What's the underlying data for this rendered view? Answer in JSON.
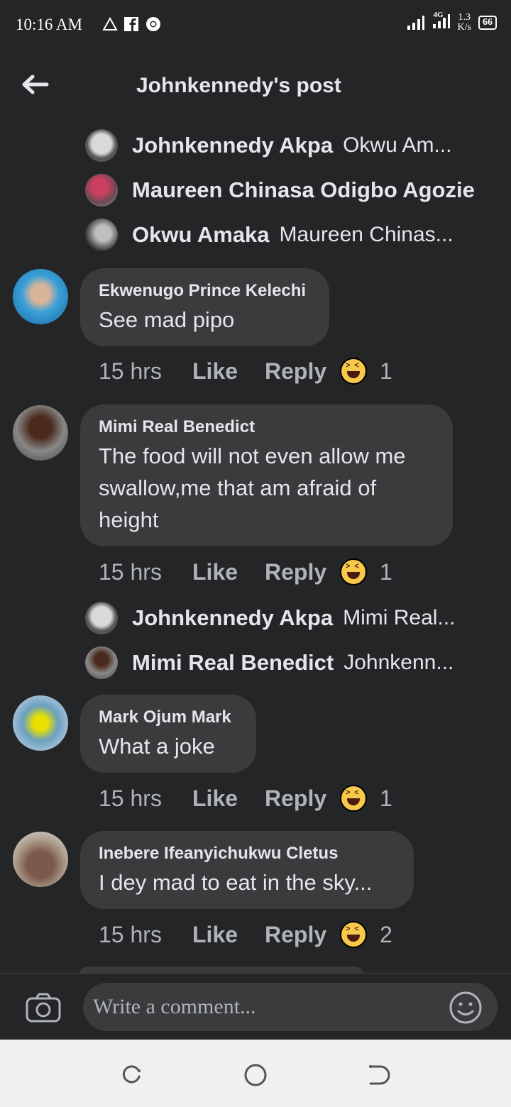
{
  "status": {
    "time": "10:16 AM",
    "network": "4G",
    "speed_value": "1.3",
    "speed_unit": "K/s",
    "battery": "66"
  },
  "header": {
    "title": "Johnkennedy's post"
  },
  "reply_threads": [
    {
      "name": "Johnkennedy Akpa",
      "text": "Okwu Am..."
    },
    {
      "name": "Maureen Chinasa Odigbo Agozie",
      "text": ""
    },
    {
      "name": "Okwu Amaka",
      "text": "Maureen Chinas..."
    }
  ],
  "comments": [
    {
      "name": "Ekwenugo Prince Kelechi",
      "text": "See mad pipo",
      "time": "15 hrs",
      "like": "Like",
      "reply": "Reply",
      "reactions": "1"
    },
    {
      "name": "Mimi Real Benedict",
      "text_lines": [
        "The food will not even allow me",
        "swallow,me that am afraid of",
        "height"
      ],
      "time": "15 hrs",
      "like": "Like",
      "reply": "Reply",
      "reactions": "1"
    },
    {
      "name": "Mark Ojum Mark",
      "text": "What a joke",
      "time": "15 hrs",
      "like": "Like",
      "reply": "Reply",
      "reactions": "1"
    },
    {
      "name": "Inebere Ifeanyichukwu Cletus",
      "text": "I dey mad to eat in the sky...",
      "time": "15 hrs",
      "like": "Like",
      "reply": "Reply",
      "reactions": "2"
    }
  ],
  "reply_threads_2": [
    {
      "name": "Johnkennedy Akpa",
      "text": "Mimi Real..."
    },
    {
      "name": "Mimi Real Benedict",
      "text": "Johnkenn..."
    }
  ],
  "composer": {
    "placeholder": "Write a comment..."
  },
  "colors": {
    "background": "#242526",
    "bubble": "#3a3b3c",
    "text": "#e4e6eb",
    "meta": "#b0b3b8"
  }
}
